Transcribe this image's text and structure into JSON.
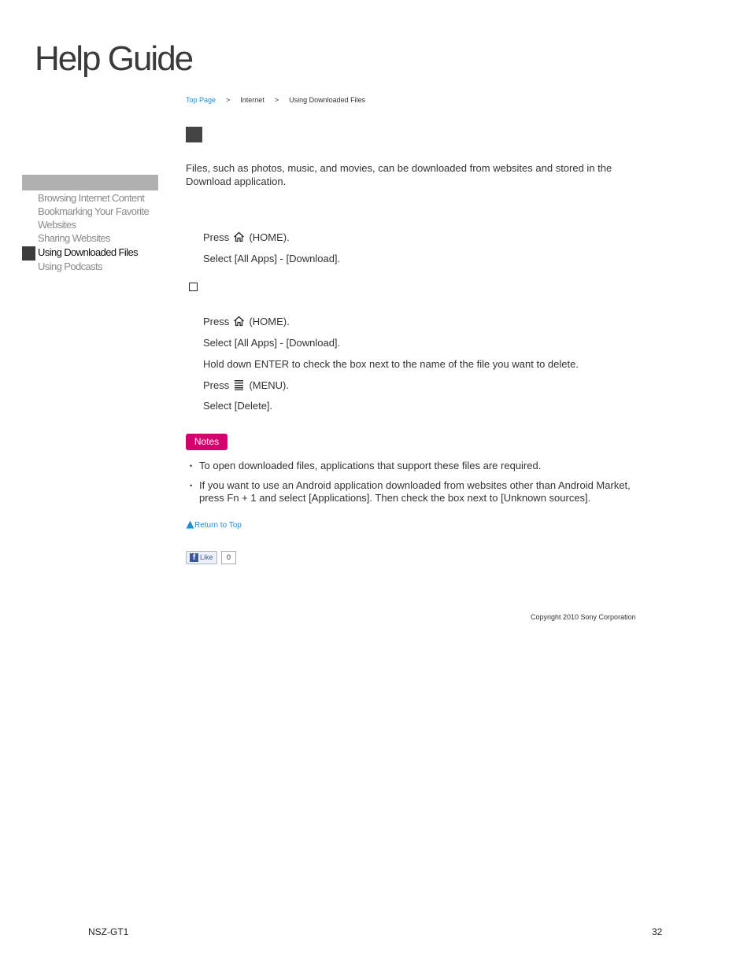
{
  "header": {
    "title": "Help Guide"
  },
  "breadcrumb": {
    "items": [
      "Top Page",
      "Internet",
      "Using Downloaded Files"
    ],
    "separator": ">"
  },
  "sidebar": {
    "items": [
      {
        "label": "Browsing Internet Content"
      },
      {
        "label": "Bookmarking Your Favorite"
      },
      {
        "label": "Websites"
      },
      {
        "label": "Sharing Websites"
      },
      {
        "label": "Using Downloaded Files",
        "active": true
      },
      {
        "label": "Using Podcasts"
      }
    ]
  },
  "main": {
    "intro": "Files, such as photos, music, and movies, can be downloaded from websites and stored in the Download application.",
    "steps_open": [
      {
        "pre": "Press ",
        "icon": "home-icon",
        "post": " (HOME)."
      },
      {
        "text": "Select [All Apps] - [Download]."
      }
    ],
    "steps_delete": [
      {
        "pre": "Press ",
        "icon": "home-icon",
        "post": " (HOME)."
      },
      {
        "text": "Select [All Apps] - [Download]."
      },
      {
        "text": "Hold down ENTER to check the box next to the name of the file you want to delete."
      },
      {
        "pre": "Press ",
        "icon": "menu-icon",
        "post": " (MENU)."
      },
      {
        "text": "Select [Delete]."
      }
    ],
    "notes_label": "Notes",
    "notes": [
      "To open downloaded files, applications that support these files are required.",
      "If you want to use an Android application downloaded from websites other than Android Market, press Fn + 1 and select [Applications]. Then check the box next to [Unknown sources]."
    ],
    "return_top": "Return to Top",
    "like": {
      "label": "Like",
      "count": "0"
    },
    "copyright": "Copyright 2010 Sony Corporation"
  },
  "footer": {
    "model": "NSZ-GT1",
    "page": "32"
  },
  "colors": {
    "accent_link": "#1a8fd6",
    "notes_badge": "#d4006d",
    "sidebar_header": "#b0b0b0"
  }
}
